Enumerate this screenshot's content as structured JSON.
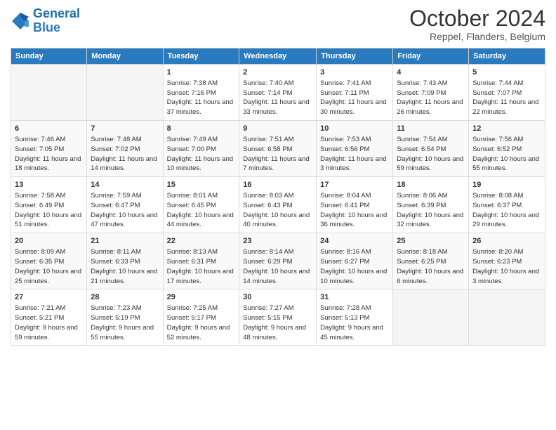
{
  "logo": {
    "line1": "General",
    "line2": "Blue"
  },
  "title": "October 2024",
  "location": "Reppel, Flanders, Belgium",
  "days_header": [
    "Sunday",
    "Monday",
    "Tuesday",
    "Wednesday",
    "Thursday",
    "Friday",
    "Saturday"
  ],
  "weeks": [
    [
      {
        "day": "",
        "sunrise": "",
        "sunset": "",
        "daylight": ""
      },
      {
        "day": "",
        "sunrise": "",
        "sunset": "",
        "daylight": ""
      },
      {
        "day": "1",
        "sunrise": "Sunrise: 7:38 AM",
        "sunset": "Sunset: 7:16 PM",
        "daylight": "Daylight: 11 hours and 37 minutes."
      },
      {
        "day": "2",
        "sunrise": "Sunrise: 7:40 AM",
        "sunset": "Sunset: 7:14 PM",
        "daylight": "Daylight: 11 hours and 33 minutes."
      },
      {
        "day": "3",
        "sunrise": "Sunrise: 7:41 AM",
        "sunset": "Sunset: 7:11 PM",
        "daylight": "Daylight: 11 hours and 30 minutes."
      },
      {
        "day": "4",
        "sunrise": "Sunrise: 7:43 AM",
        "sunset": "Sunset: 7:09 PM",
        "daylight": "Daylight: 11 hours and 26 minutes."
      },
      {
        "day": "5",
        "sunrise": "Sunrise: 7:44 AM",
        "sunset": "Sunset: 7:07 PM",
        "daylight": "Daylight: 11 hours and 22 minutes."
      }
    ],
    [
      {
        "day": "6",
        "sunrise": "Sunrise: 7:46 AM",
        "sunset": "Sunset: 7:05 PM",
        "daylight": "Daylight: 11 hours and 18 minutes."
      },
      {
        "day": "7",
        "sunrise": "Sunrise: 7:48 AM",
        "sunset": "Sunset: 7:02 PM",
        "daylight": "Daylight: 11 hours and 14 minutes."
      },
      {
        "day": "8",
        "sunrise": "Sunrise: 7:49 AM",
        "sunset": "Sunset: 7:00 PM",
        "daylight": "Daylight: 11 hours and 10 minutes."
      },
      {
        "day": "9",
        "sunrise": "Sunrise: 7:51 AM",
        "sunset": "Sunset: 6:58 PM",
        "daylight": "Daylight: 11 hours and 7 minutes."
      },
      {
        "day": "10",
        "sunrise": "Sunrise: 7:53 AM",
        "sunset": "Sunset: 6:56 PM",
        "daylight": "Daylight: 11 hours and 3 minutes."
      },
      {
        "day": "11",
        "sunrise": "Sunrise: 7:54 AM",
        "sunset": "Sunset: 6:54 PM",
        "daylight": "Daylight: 10 hours and 59 minutes."
      },
      {
        "day": "12",
        "sunrise": "Sunrise: 7:56 AM",
        "sunset": "Sunset: 6:52 PM",
        "daylight": "Daylight: 10 hours and 55 minutes."
      }
    ],
    [
      {
        "day": "13",
        "sunrise": "Sunrise: 7:58 AM",
        "sunset": "Sunset: 6:49 PM",
        "daylight": "Daylight: 10 hours and 51 minutes."
      },
      {
        "day": "14",
        "sunrise": "Sunrise: 7:59 AM",
        "sunset": "Sunset: 6:47 PM",
        "daylight": "Daylight: 10 hours and 47 minutes."
      },
      {
        "day": "15",
        "sunrise": "Sunrise: 8:01 AM",
        "sunset": "Sunset: 6:45 PM",
        "daylight": "Daylight: 10 hours and 44 minutes."
      },
      {
        "day": "16",
        "sunrise": "Sunrise: 8:03 AM",
        "sunset": "Sunset: 6:43 PM",
        "daylight": "Daylight: 10 hours and 40 minutes."
      },
      {
        "day": "17",
        "sunrise": "Sunrise: 8:04 AM",
        "sunset": "Sunset: 6:41 PM",
        "daylight": "Daylight: 10 hours and 36 minutes."
      },
      {
        "day": "18",
        "sunrise": "Sunrise: 8:06 AM",
        "sunset": "Sunset: 6:39 PM",
        "daylight": "Daylight: 10 hours and 32 minutes."
      },
      {
        "day": "19",
        "sunrise": "Sunrise: 8:08 AM",
        "sunset": "Sunset: 6:37 PM",
        "daylight": "Daylight: 10 hours and 29 minutes."
      }
    ],
    [
      {
        "day": "20",
        "sunrise": "Sunrise: 8:09 AM",
        "sunset": "Sunset: 6:35 PM",
        "daylight": "Daylight: 10 hours and 25 minutes."
      },
      {
        "day": "21",
        "sunrise": "Sunrise: 8:11 AM",
        "sunset": "Sunset: 6:33 PM",
        "daylight": "Daylight: 10 hours and 21 minutes."
      },
      {
        "day": "22",
        "sunrise": "Sunrise: 8:13 AM",
        "sunset": "Sunset: 6:31 PM",
        "daylight": "Daylight: 10 hours and 17 minutes."
      },
      {
        "day": "23",
        "sunrise": "Sunrise: 8:14 AM",
        "sunset": "Sunset: 6:29 PM",
        "daylight": "Daylight: 10 hours and 14 minutes."
      },
      {
        "day": "24",
        "sunrise": "Sunrise: 8:16 AM",
        "sunset": "Sunset: 6:27 PM",
        "daylight": "Daylight: 10 hours and 10 minutes."
      },
      {
        "day": "25",
        "sunrise": "Sunrise: 8:18 AM",
        "sunset": "Sunset: 6:25 PM",
        "daylight": "Daylight: 10 hours and 6 minutes."
      },
      {
        "day": "26",
        "sunrise": "Sunrise: 8:20 AM",
        "sunset": "Sunset: 6:23 PM",
        "daylight": "Daylight: 10 hours and 3 minutes."
      }
    ],
    [
      {
        "day": "27",
        "sunrise": "Sunrise: 7:21 AM",
        "sunset": "Sunset: 5:21 PM",
        "daylight": "Daylight: 9 hours and 59 minutes."
      },
      {
        "day": "28",
        "sunrise": "Sunrise: 7:23 AM",
        "sunset": "Sunset: 5:19 PM",
        "daylight": "Daylight: 9 hours and 55 minutes."
      },
      {
        "day": "29",
        "sunrise": "Sunrise: 7:25 AM",
        "sunset": "Sunset: 5:17 PM",
        "daylight": "Daylight: 9 hours and 52 minutes."
      },
      {
        "day": "30",
        "sunrise": "Sunrise: 7:27 AM",
        "sunset": "Sunset: 5:15 PM",
        "daylight": "Daylight: 9 hours and 48 minutes."
      },
      {
        "day": "31",
        "sunrise": "Sunrise: 7:28 AM",
        "sunset": "Sunset: 5:13 PM",
        "daylight": "Daylight: 9 hours and 45 minutes."
      },
      {
        "day": "",
        "sunrise": "",
        "sunset": "",
        "daylight": ""
      },
      {
        "day": "",
        "sunrise": "",
        "sunset": "",
        "daylight": ""
      }
    ]
  ]
}
